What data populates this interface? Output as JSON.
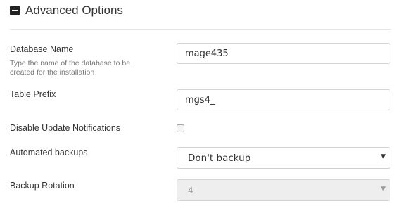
{
  "section": {
    "title": "Advanced Options",
    "icon": "minus-square-icon"
  },
  "fields": {
    "database_name": {
      "label": "Database Name",
      "help": "Type the name of the database to be created for the installation",
      "value": "mage435"
    },
    "table_prefix": {
      "label": "Table Prefix",
      "value": "mgs4_"
    },
    "disable_updates": {
      "label": "Disable Update Notifications",
      "checked": false
    },
    "automated_backups": {
      "label": "Automated backups",
      "selected": "Don't backup",
      "arrow": "▼"
    },
    "backup_rotation": {
      "label": "Backup Rotation",
      "selected": "4",
      "disabled": true,
      "arrow": "▼"
    }
  }
}
